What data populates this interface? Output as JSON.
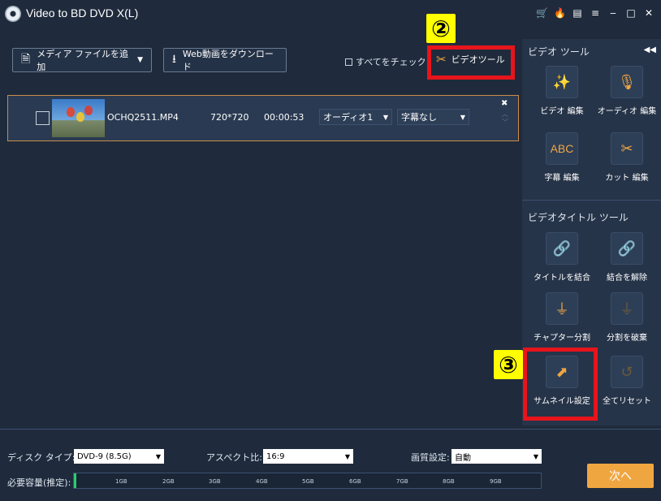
{
  "window": {
    "title": "Video to BD DVD X(L)",
    "icons": [
      "cart-icon",
      "flame-icon",
      "document-icon",
      "menu-icon",
      "minimize-icon",
      "maximize-icon",
      "close-icon"
    ],
    "icon_glyphs": [
      "🛒",
      "🔥",
      "▤",
      "≡",
      "‒",
      "□",
      "✕"
    ]
  },
  "toolbar": {
    "add_media_label": "メディア ファイルを追加",
    "web_download_label": "Web動画をダウンロード",
    "check_all_label": "すべてをチェック",
    "video_tool_label": "ビデオツール"
  },
  "annotations": {
    "marker_2": "②",
    "marker_3": "③"
  },
  "file": {
    "name": "OCHQ2511.MP4",
    "resolution": "720*720",
    "duration": "00:00:53",
    "audio": "オーディオ1",
    "subtitle": "字幕なし"
  },
  "sidebar": {
    "video_tools_header": "ビデオ ツール",
    "title_tools_header": "ビデオタイトル ツール",
    "tools": [
      {
        "label": "ビデオ 編集",
        "icon": "magic-wand-icon",
        "glyph": "✨"
      },
      {
        "label": "オーディオ 編集",
        "icon": "microphone-icon",
        "glyph": "🎙"
      },
      {
        "label": "字幕 編集",
        "icon": "abc-icon",
        "glyph": "ABC"
      },
      {
        "label": "カット 編集",
        "icon": "scissors-icon",
        "glyph": "✂"
      }
    ],
    "title_tools": [
      {
        "label": "タイトルを結合",
        "icon": "link-icon",
        "glyph": "🔗"
      },
      {
        "label": "結合を解除",
        "icon": "unlink-icon",
        "glyph": "🔗"
      },
      {
        "label": "チャプター分割",
        "icon": "split-icon",
        "glyph": "⏚"
      },
      {
        "label": "分割を破棄",
        "icon": "split-discard-icon",
        "glyph": "⏚"
      },
      {
        "label": "サムネイル設定",
        "icon": "thumbnail-icon",
        "glyph": "⬈"
      },
      {
        "label": "全てリセット",
        "icon": "reset-icon",
        "glyph": "↺"
      }
    ]
  },
  "bottom": {
    "disc_type_label": "ディスク タイプ:",
    "disc_type_value": "DVD-9 (8.5G)",
    "aspect_label": "アスペクト比:",
    "aspect_value": "16:9",
    "quality_label": "画質設定:",
    "quality_value": "自動",
    "capacity_label": "必要容量(推定):",
    "capacity_ticks": [
      "1GB",
      "2GB",
      "3GB",
      "4GB",
      "5GB",
      "6GB",
      "7GB",
      "8GB",
      "9GB"
    ],
    "capacity_used_fraction": 0.005,
    "next_label": "次へ"
  },
  "colors": {
    "accent": "#f0a640",
    "highlight_box": "#e8141c",
    "marker_bg": "#ffff00",
    "background": "#1f2b3c"
  }
}
